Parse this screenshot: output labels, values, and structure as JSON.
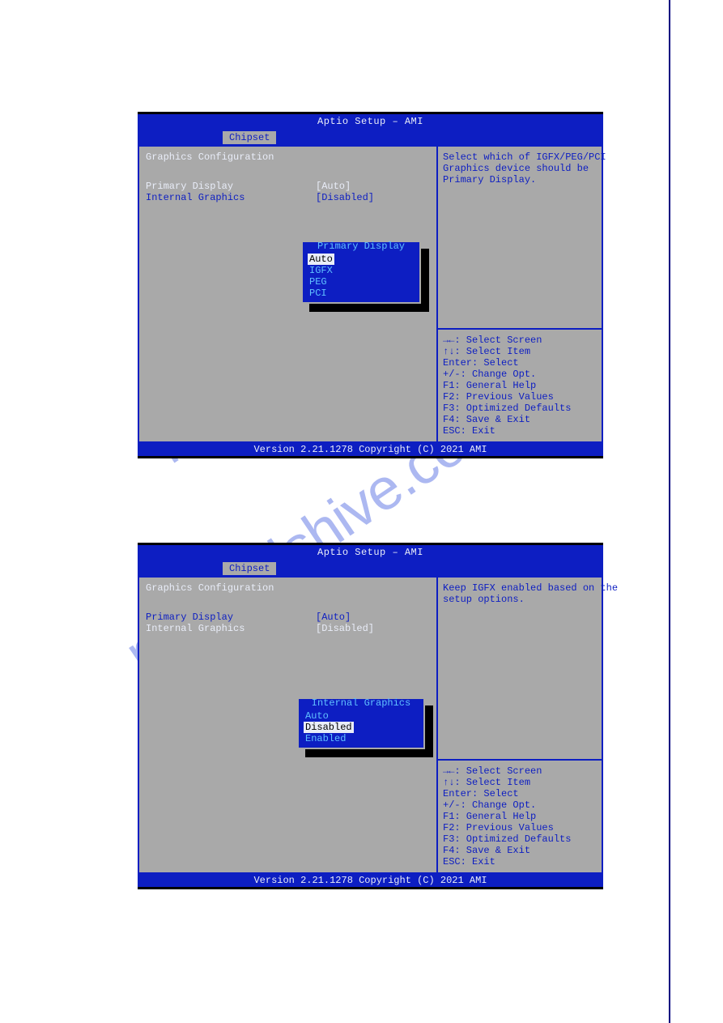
{
  "watermark": "manualshive.com",
  "bios1": {
    "title": "Aptio Setup – AMI",
    "tab": "Chipset",
    "section": "Graphics Configuration",
    "item1": {
      "label": "Primary Display",
      "value": "[Auto]"
    },
    "item2": {
      "label": "Internal Graphics",
      "value": "[Disabled]"
    },
    "help": {
      "l1": "Select which of IGFX/PEG/PCI",
      "l2": "Graphics device should be",
      "l3": "Primary Display."
    },
    "keys": {
      "k1": "→←: Select Screen",
      "k2": "↑↓: Select Item",
      "k3": "Enter: Select",
      "k4": "+/-: Change Opt.",
      "k5": "F1: General Help",
      "k6": "F2: Previous Values",
      "k7": "F3: Optimized Defaults",
      "k8": "F4: Save & Exit",
      "k9": "ESC: Exit"
    },
    "popup": {
      "title": "Primary Display",
      "opts": [
        "Auto",
        "IGFX",
        "PEG",
        "PCI"
      ],
      "selected": 0
    },
    "footer": "Version 2.21.1278 Copyright (C) 2021 AMI"
  },
  "bios2": {
    "title": "Aptio Setup – AMI",
    "tab": "Chipset",
    "section": "Graphics Configuration",
    "item1": {
      "label": "Primary Display",
      "value": "[Auto]"
    },
    "item2": {
      "label": "Internal Graphics",
      "value": "[Disabled]"
    },
    "help": {
      "l1": "Keep IGFX enabled based on the",
      "l2": "setup options.",
      "l3": ""
    },
    "keys": {
      "k1": "→←: Select Screen",
      "k2": "↑↓: Select Item",
      "k3": "Enter: Select",
      "k4": "+/-: Change Opt.",
      "k5": "F1: General Help",
      "k6": "F2: Previous Values",
      "k7": "F3: Optimized Defaults",
      "k8": "F4: Save & Exit",
      "k9": "ESC: Exit"
    },
    "popup": {
      "title": "Internal Graphics",
      "opts": [
        "Auto",
        "Disabled",
        "Enabled"
      ],
      "selected": 1
    },
    "footer": "Version 2.21.1278 Copyright (C) 2021 AMI"
  }
}
